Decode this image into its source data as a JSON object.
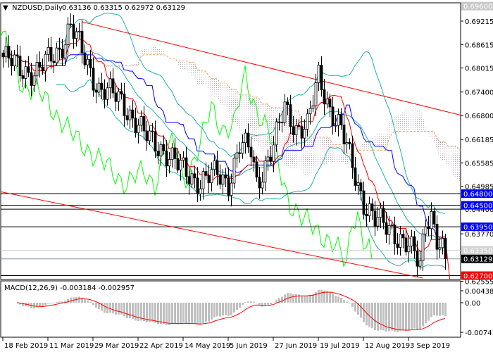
{
  "chart_data": {
    "type": "candlestick",
    "symbol": "NZDUSD",
    "timeframe": "Daily",
    "header": {
      "title": "NZDUSD,Daily",
      "ohlc": "0.63136 0.63315 0.62972 0.63129"
    },
    "close_path": [
      [
        0,
        0.683
      ],
      [
        6,
        0.68
      ],
      [
        12,
        0.679
      ],
      [
        20,
        0.685
      ],
      [
        24,
        0.691
      ],
      [
        28,
        0.684
      ],
      [
        34,
        0.675
      ],
      [
        42,
        0.672
      ],
      [
        50,
        0.663
      ],
      [
        56,
        0.66
      ],
      [
        62,
        0.655
      ],
      [
        70,
        0.651
      ],
      [
        76,
        0.653
      ],
      [
        80,
        0.651
      ],
      [
        84,
        0.66
      ],
      [
        88,
        0.659
      ],
      [
        90,
        0.651
      ],
      [
        96,
        0.66
      ],
      [
        100,
        0.67
      ],
      [
        104,
        0.665
      ],
      [
        108,
        0.665
      ],
      [
        112,
        0.678
      ],
      [
        116,
        0.67
      ],
      [
        120,
        0.664
      ],
      [
        124,
        0.655
      ],
      [
        128,
        0.646
      ],
      [
        132,
        0.641
      ],
      [
        138,
        0.639
      ],
      [
        144,
        0.634
      ],
      [
        148,
        0.63
      ],
      [
        150,
        0.642
      ],
      [
        152,
        0.643
      ],
      [
        154,
        0.636
      ],
      [
        157,
        0.63129
      ]
    ],
    "y_axis": {
      "ticks": [
        "0.69215",
        "0.68615",
        "0.68015",
        "0.67400",
        "0.66800",
        "0.66185",
        "0.65585",
        "0.64985",
        "0.64400",
        "0.63770",
        "0.62555"
      ],
      "range": [
        0.6255,
        0.6966
      ]
    },
    "price_labels": [
      {
        "value": "0.69600",
        "color": "#c8c8c8"
      },
      {
        "value": "0.64800",
        "color": "#0000ff"
      },
      {
        "value": "0.64500",
        "color": "#0000ff"
      },
      {
        "value": "0.63950",
        "color": "#0000ff"
      },
      {
        "value": "0.63350",
        "color": "#d3d3d3"
      },
      {
        "value": "0.63129",
        "color": "#000000"
      },
      {
        "value": "0.62700",
        "color": "#ff0000"
      }
    ],
    "x_axis": {
      "ticks": [
        "18 Feb 2019",
        "11 Mar 2019",
        "29 Mar 2019",
        "22 Apr 2019",
        "14 May 2019",
        "5 Jun 2019",
        "27 Jun 2019",
        "19 Jul 2019",
        "12 Aug 2019",
        "3 Sep 2019"
      ],
      "tick_bars": [
        0,
        16,
        32,
        48,
        64,
        80,
        96,
        112,
        128,
        144
      ]
    },
    "channel": {
      "color": "#ff0000",
      "upper": [
        [
          28,
          0.692
        ],
        [
          163,
          0.668
        ]
      ],
      "lower": [
        [
          -1,
          0.6485
        ],
        [
          149,
          0.6264
        ]
      ]
    },
    "macd": {
      "label": "MACD(12,26,9) -0.003184 -0.002957",
      "ticks": [
        "0.004384",
        "0.00",
        "-0.007412"
      ],
      "range": [
        -0.007412,
        0.004384
      ]
    },
    "colors": {
      "tenkan": "#ff0000",
      "kijun": "#0000ff",
      "bands": "#20b2aa",
      "chikou": "#00ff00",
      "cloud_edge": "#f4a460",
      "cloud_dots": "#c0b0c0",
      "macd_hist": "#c0c0c0",
      "macd_signal": "#ff0000"
    }
  }
}
